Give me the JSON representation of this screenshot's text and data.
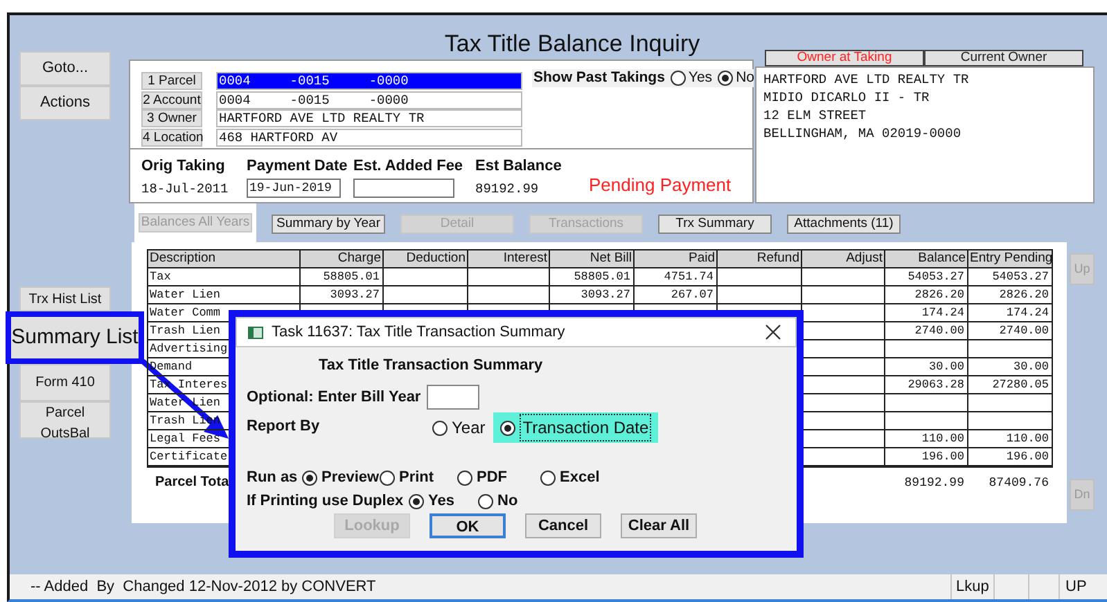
{
  "window": {
    "title": "Tax Title Balance Inquiry"
  },
  "action_buttons": [
    {
      "label": "Goto..."
    },
    {
      "label": "Actions"
    }
  ],
  "report_buttons": [
    {
      "label": "Trx Hist List",
      "highlighted": false
    },
    {
      "label": "Summary List",
      "highlighted": true
    },
    {
      "label": "Form 410",
      "highlighted": false
    },
    {
      "label": "Parcel OutsBal",
      "highlighted": false
    }
  ],
  "parcel": {
    "fields": [
      {
        "label": "1 Parcel",
        "value": "0004     -0015     -0000",
        "selected": true
      },
      {
        "label": "2 Account",
        "value": "0004     -0015     -0000",
        "selected": false
      },
      {
        "label": "3 Owner",
        "value": "HARTFORD AVE LTD REALTY TR",
        "selected": false
      },
      {
        "label": "4 Location",
        "value": "468 HARTFORD AV",
        "selected": false
      }
    ]
  },
  "show_past_takings": {
    "label": "Show Past Takings",
    "options": [
      {
        "label": "Yes",
        "selected": false
      },
      {
        "label": "No",
        "selected": true
      }
    ]
  },
  "summary": [
    {
      "label": "Orig Taking",
      "value": "18-Jul-2011",
      "kind": "text"
    },
    {
      "label": "Payment Date",
      "value": "19-Jun-2019",
      "kind": "field"
    },
    {
      "label": "Est. Added Fee",
      "kind": "field"
    },
    {
      "label": "Est Balance",
      "value": "89192.99",
      "kind": "text"
    }
  ],
  "status_message": "Pending Payment",
  "owner_panel": {
    "tabs": [
      {
        "label": "Owner at Taking",
        "selected": true
      },
      {
        "label": "Current Owner",
        "selected": false
      }
    ],
    "lines": [
      "HARTFORD AVE LTD REALTY TR",
      "MIDIO DICARLO II - TR",
      "12 ELM STREET",
      "BELLINGHAM, MA 02019-0000"
    ]
  },
  "view_tabs": [
    {
      "label": "Balances All Years",
      "selected": true,
      "disabled": true
    },
    {
      "label": "Summary by Year",
      "selected": false,
      "disabled": false
    },
    {
      "label": "Detail",
      "selected": false,
      "disabled": true
    },
    {
      "label": "Transactions",
      "selected": false,
      "disabled": true
    },
    {
      "label": "Trx Summary",
      "selected": false,
      "disabled": false
    },
    {
      "label": "Attachments (11)",
      "selected": false,
      "disabled": false
    }
  ],
  "table": {
    "columns": [
      "Description",
      "Charge",
      "Deduction",
      "Interest",
      "Net Bill",
      "Paid",
      "Refund",
      "Adjust",
      "Balance",
      "Entry Pending"
    ],
    "rows": [
      {
        "description": "Tax",
        "charge": "58805.01",
        "net_bill": "58805.01",
        "paid": "4751.74",
        "balance": "54053.27",
        "entry_pending": "54053.27"
      },
      {
        "description": "Water Lien",
        "charge": "3093.27",
        "net_bill": "3093.27",
        "paid": "267.07",
        "balance": "2826.20",
        "entry_pending": "2826.20"
      },
      {
        "description": "Water Comm",
        "balance": "174.24",
        "entry_pending": "174.24"
      },
      {
        "description": "Trash Lien",
        "balance": "2740.00",
        "entry_pending": "2740.00"
      },
      {
        "description": "Advertising"
      },
      {
        "description": "Demand",
        "balance": "30.00",
        "entry_pending": "30.00"
      },
      {
        "description": "Tax Interes",
        "balance": "29063.28",
        "entry_pending": "27280.05"
      },
      {
        "description": "Water Lien"
      },
      {
        "description": "Trash Lien"
      },
      {
        "description": "Legal Fees",
        "balance": "110.00",
        "entry_pending": "110.00"
      },
      {
        "description": "Certificate",
        "balance": "196.00",
        "entry_pending": "196.00"
      }
    ],
    "total": {
      "label": "Parcel Tota",
      "balance": "89192.99",
      "entry_pending": "87409.76"
    }
  },
  "scroll_buttons": [
    {
      "label": "Up",
      "disabled": true
    },
    {
      "label": "Dn",
      "disabled": true
    }
  ],
  "status_bar": {
    "message": "-- Added  By  Changed 12-Nov-2012 by CONVERT",
    "indicators": [
      "Lkup",
      "UP"
    ]
  },
  "dialog": {
    "title": "Task 11637: Tax Title Transaction Summary",
    "heading": "Tax Title Transaction Summary",
    "bill_year": {
      "label": "Optional: Enter Bill Year"
    },
    "report_by": {
      "label": "Report By",
      "options": [
        {
          "label": "Year",
          "selected": false,
          "focused": false
        },
        {
          "label": "Transaction Date",
          "selected": true,
          "focused": true
        }
      ]
    },
    "run_as": {
      "label": "Run as",
      "options": [
        {
          "label": "Preview",
          "selected": true
        },
        {
          "label": "Print",
          "selected": false
        },
        {
          "label": "PDF",
          "selected": false
        },
        {
          "label": "Excel",
          "selected": false
        }
      ]
    },
    "duplex": {
      "label": "If Printing use Duplex",
      "options": [
        {
          "label": "Yes",
          "selected": true
        },
        {
          "label": "No",
          "selected": false
        }
      ]
    },
    "buttons": [
      {
        "label": "Lookup",
        "disabled": true,
        "default": false
      },
      {
        "label": "OK",
        "disabled": false,
        "default": true
      },
      {
        "label": "Cancel",
        "disabled": false,
        "default": false
      },
      {
        "label": "Clear All",
        "disabled": false,
        "default": false
      }
    ]
  }
}
